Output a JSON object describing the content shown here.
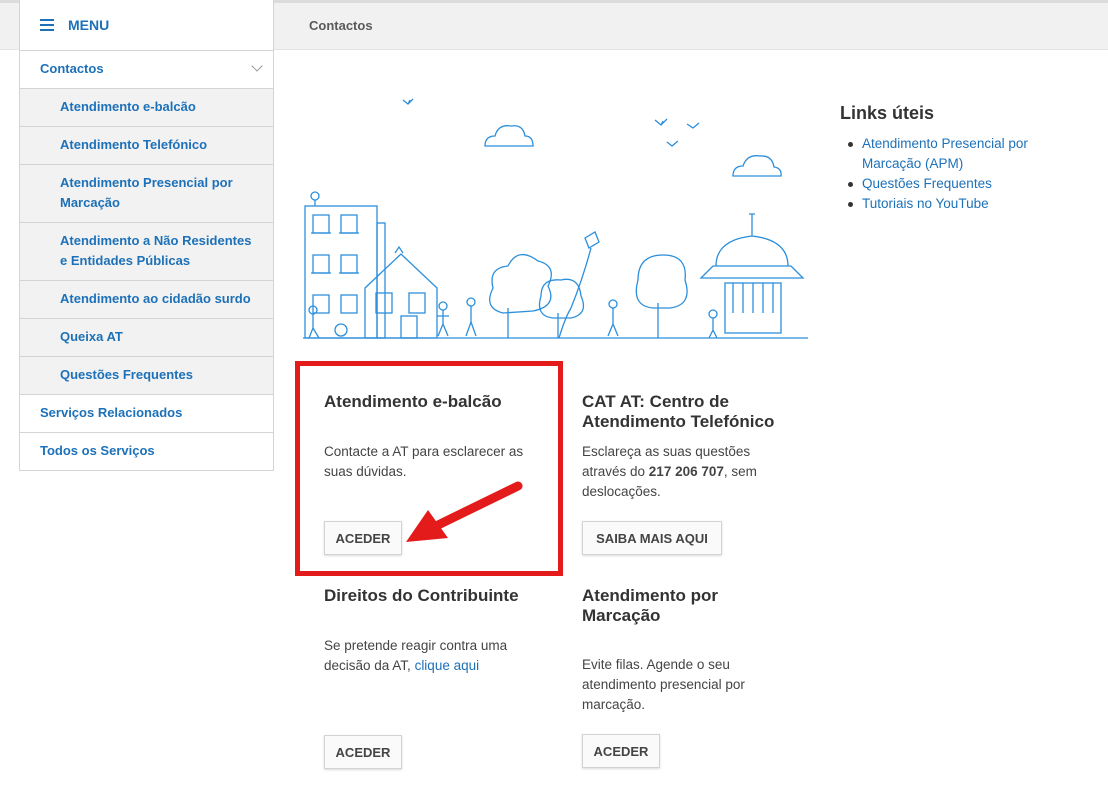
{
  "breadcrumb": "Contactos",
  "menu": {
    "title": "MENU",
    "items": [
      {
        "label": "Contactos",
        "level": "top",
        "expanded": true
      },
      {
        "label": "Atendimento e-balcão",
        "level": "sub"
      },
      {
        "label": "Atendimento Telefónico",
        "level": "sub"
      },
      {
        "label": "Atendimento Presencial por Marcação",
        "level": "sub"
      },
      {
        "label": "Atendimento a Não Residentes e Entidades Públicas",
        "level": "sub"
      },
      {
        "label": "Atendimento ao cidadão surdo",
        "level": "sub"
      },
      {
        "label": "Queixa AT",
        "level": "sub"
      },
      {
        "label": "Questões Frequentes",
        "level": "sub"
      },
      {
        "label": "Serviços Relacionados",
        "level": "top"
      },
      {
        "label": "Todos os Serviços",
        "level": "top"
      }
    ]
  },
  "links": {
    "title": "Links úteis",
    "items": [
      "Atendimento Presencial por Marcação (APM)",
      "Questões Frequentes",
      "Tutoriais no YouTube"
    ]
  },
  "cards": {
    "ebalcao": {
      "title": "Atendimento e-balcão",
      "text": "Contacte a AT para esclarecer as suas dúvidas.",
      "button": "ACEDER"
    },
    "cat": {
      "title": "CAT AT: Centro de Atendimento Telefónico",
      "text_before": "Esclareça as suas questões através do ",
      "phone": "217 206 707",
      "text_after": ", sem deslocações.",
      "button": "SAIBA MAIS AQUI"
    },
    "direitos": {
      "title": "Direitos do Contribuinte",
      "text": "Se pretende reagir contra uma decisão da AT, ",
      "link": "clique aqui",
      "button": "ACEDER"
    },
    "marcacao": {
      "title": "Atendimento por Marcação",
      "text": "Evite filas. Agende o seu atendimento presencial por marcação.",
      "button": "ACEDER"
    }
  },
  "colors": {
    "accent": "#1d71b8",
    "highlight": "#e41b1b"
  },
  "icons": [
    "hamburger-icon",
    "chevron-down-icon",
    "city-illustration",
    "red-arrow"
  ]
}
